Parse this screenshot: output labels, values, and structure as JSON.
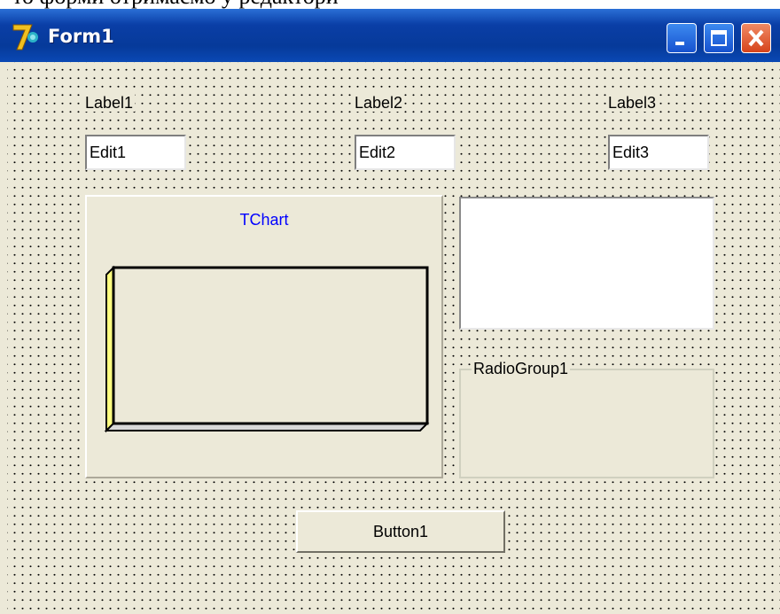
{
  "window": {
    "title": "Form1"
  },
  "labels": {
    "label1": "Label1",
    "label2": "Label2",
    "label3": "Label3"
  },
  "edits": {
    "edit1": "Edit1",
    "edit2": "Edit2",
    "edit3": "Edit3"
  },
  "chart": {
    "title": "TChart",
    "title_color": "#0000ff",
    "wall_color": "#ffff80"
  },
  "radio_group": {
    "caption": "RadioGroup1"
  },
  "button": {
    "label": "Button1"
  },
  "icons": {
    "app": "delphi-7-icon",
    "minimize": "minimize-icon",
    "maximize": "maximize-icon",
    "close": "close-icon"
  }
}
